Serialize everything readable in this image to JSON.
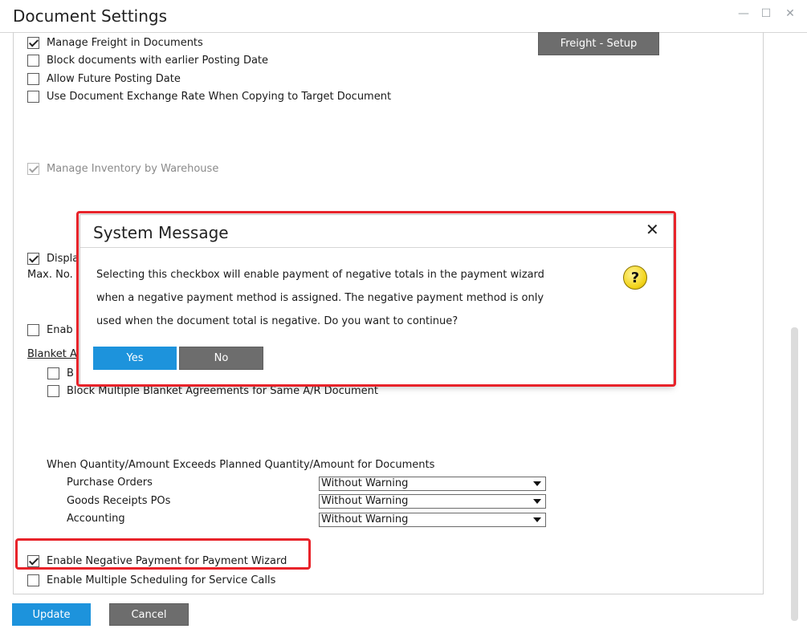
{
  "window": {
    "title": "Document Settings",
    "min_glyph": "—",
    "max_glyph": "☐",
    "close_glyph": "✕"
  },
  "options": {
    "manage_freight": {
      "label": "Manage Freight in Documents",
      "checked": true
    },
    "block_earlier_posting": {
      "label": "Block documents with earlier Posting Date",
      "checked": false
    },
    "allow_future_posting": {
      "label": "Allow Future Posting Date",
      "checked": false
    },
    "use_doc_exchange_rate": {
      "label": "Use Document Exchange Rate When Copying to Target Document",
      "checked": false
    },
    "manage_inventory_by_warehouse": {
      "label": "Manage Inventory by Warehouse",
      "checked": true,
      "disabled": true
    },
    "display_partial": {
      "label": "Displa",
      "checked": true
    },
    "max_no_partial": {
      "label": "Max. No."
    },
    "enable_partial": {
      "label": "Enab",
      "checked": false
    },
    "blanket_partial": {
      "label": "Blanket A"
    },
    "blanket_b_partial": {
      "label": "B",
      "checked": false
    },
    "block_multiple_blanket": {
      "label": "Block Multiple Blanket Agreements for Same A/R Document",
      "checked": false
    }
  },
  "freight_setup_label": "Freight - Setup",
  "exceed_section": {
    "heading": "When Quantity/Amount Exceeds Planned Quantity/Amount for Documents",
    "rows": [
      {
        "label": "Purchase Orders",
        "value": "Without Warning"
      },
      {
        "label": "Goods Receipts POs",
        "value": "Without Warning"
      },
      {
        "label": "Accounting",
        "value": "Without Warning"
      }
    ]
  },
  "bottom_options": {
    "enable_negative_payment": {
      "label": "Enable Negative Payment for Payment Wizard",
      "checked": true
    },
    "enable_multiple_scheduling": {
      "label": "Enable Multiple Scheduling for Service Calls",
      "checked": false
    }
  },
  "footer": {
    "update_label": "Update",
    "cancel_label": "Cancel"
  },
  "dialog": {
    "title": "System Message",
    "close_glyph": "✕",
    "message_lines": [
      "Selecting this checkbox will enable payment of negative totals in the payment wizard",
      "when a negative payment method is assigned. The negative payment method is only",
      "used when the document total is negative. Do you want to continue?"
    ],
    "question_icon": "?",
    "yes_label": "Yes",
    "no_label": "No"
  },
  "colors": {
    "highlight": "#e8232a",
    "primary_button": "#1d93dc",
    "secondary_button": "#6d6d6d"
  }
}
